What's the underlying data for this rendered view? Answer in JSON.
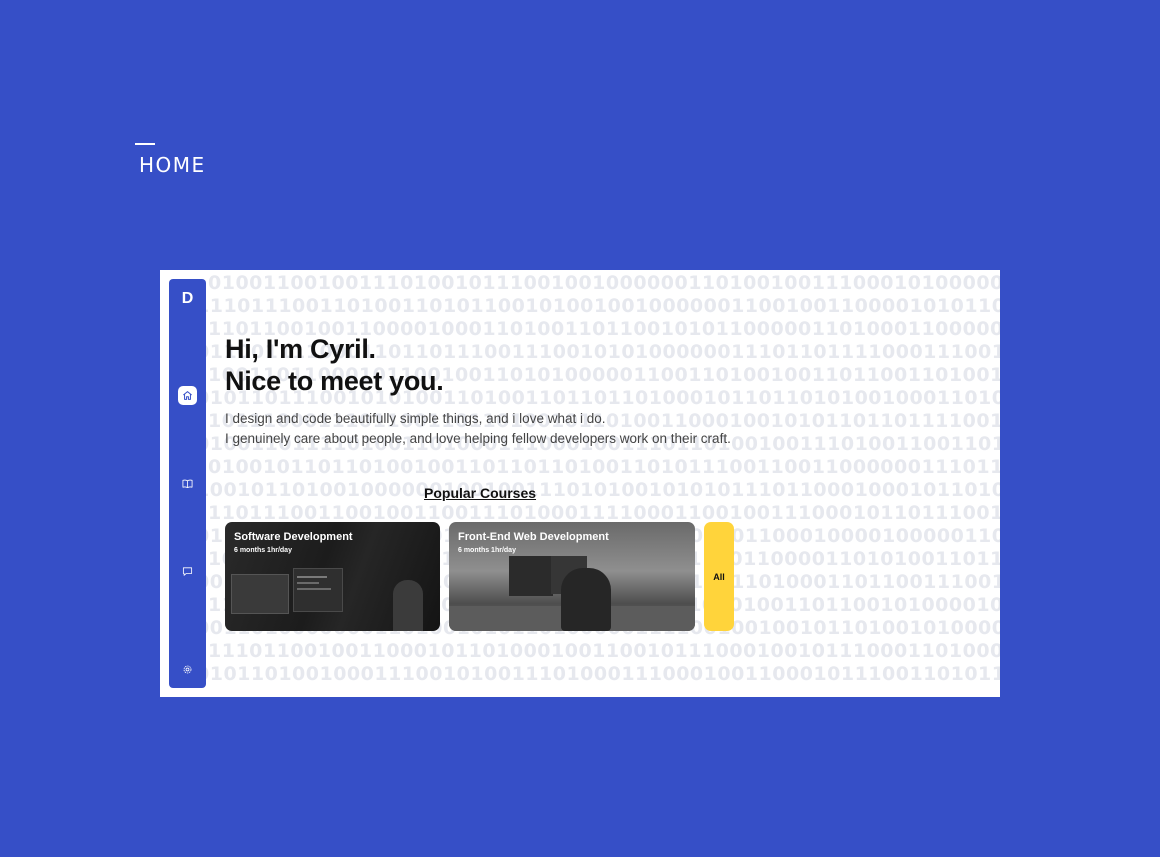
{
  "section": {
    "label": "HOME"
  },
  "sidebar": {
    "logo": "D",
    "items": [
      {
        "icon": "home-icon",
        "active": true
      },
      {
        "icon": "book-icon",
        "active": false
      },
      {
        "icon": "message-icon",
        "active": false
      },
      {
        "icon": "settings-icon",
        "active": false
      }
    ]
  },
  "hero": {
    "heading_line1": "Hi, I'm Cyril.",
    "heading_line2": "Nice to meet you.",
    "intro_line1": "I design and code beautifully simple things, and i love what i do.",
    "intro_line2": "I genuinely care about people, and love helping fellow developers work on their craft."
  },
  "courses": {
    "heading": "Popular Courses",
    "items": [
      {
        "title": "Software Development",
        "meta": "6 months 1hr/day"
      },
      {
        "title": "Front-End Web Development",
        "meta": "6 months 1hr/day"
      }
    ],
    "all_label": "All"
  },
  "colors": {
    "page_background": "#364fc7",
    "sidebar": "#364fc7",
    "all_button": "#ffd43b"
  }
}
